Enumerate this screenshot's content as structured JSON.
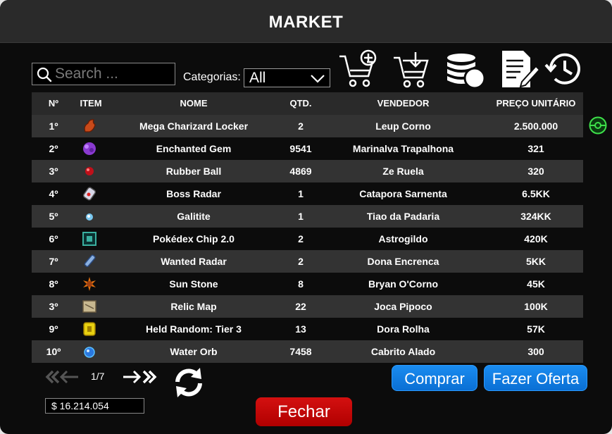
{
  "window": {
    "title": "MARKET"
  },
  "search": {
    "placeholder": "Search ..."
  },
  "category": {
    "label": "Categorias:",
    "selected": "All"
  },
  "toolbar": [
    {
      "name": "add-to-cart-icon"
    },
    {
      "name": "cart-download-icon"
    },
    {
      "name": "coins-icon"
    },
    {
      "name": "edit-document-icon"
    },
    {
      "name": "history-icon"
    }
  ],
  "table": {
    "headers": {
      "num": "Nº",
      "item": "ITEM",
      "name": "NOME",
      "qtd": "QTD.",
      "seller": "VENDEDOR",
      "price": "PREÇO UNITÁRIO"
    },
    "rows": [
      {
        "num": "1º",
        "icon": "charizard-locker-icon",
        "color": "#c84a1a",
        "name": "Mega Charizard Locker",
        "qtd": "2",
        "seller": "Leup Corno",
        "price": "2.500.000"
      },
      {
        "num": "2º",
        "icon": "gem-icon",
        "color": "#8a3ad0",
        "name": "Enchanted Gem",
        "qtd": "9541",
        "seller": "Marinalva Trapalhona",
        "price": "321"
      },
      {
        "num": "3º",
        "icon": "rubber-ball-icon",
        "color": "#c0101a",
        "name": "Rubber Ball",
        "qtd": "4869",
        "seller": "Ze Ruela",
        "price": "320"
      },
      {
        "num": "4º",
        "icon": "boss-radar-icon",
        "color": "#d8d8e8",
        "name": "Boss Radar",
        "qtd": "1",
        "seller": "Catapora Sarnenta",
        "price": "6.5KK"
      },
      {
        "num": "5º",
        "icon": "galitite-icon",
        "color": "#7ac8f0",
        "name": "Galitite",
        "qtd": "1",
        "seller": "Tiao da Padaria",
        "price": "324KK"
      },
      {
        "num": "6º",
        "icon": "pokedex-chip-icon",
        "color": "#3ab0a0",
        "name": "Pokédex Chip 2.0",
        "qtd": "2",
        "seller": "Astrogildo",
        "price": "420K"
      },
      {
        "num": "7º",
        "icon": "wanted-radar-icon",
        "color": "#8ab0e0",
        "name": "Wanted Radar",
        "qtd": "2",
        "seller": "Dona Encrenca",
        "price": "5KK"
      },
      {
        "num": "8º",
        "icon": "sun-stone-icon",
        "color": "#e07010",
        "name": "Sun Stone",
        "qtd": "8",
        "seller": "Bryan O'Corno",
        "price": "45K"
      },
      {
        "num": "3º",
        "icon": "relic-map-icon",
        "color": "#a09070",
        "name": "Relic Map",
        "qtd": "22",
        "seller": "Joca Pipoco",
        "price": "100K"
      },
      {
        "num": "9º",
        "icon": "held-random-icon",
        "color": "#e8d010",
        "name": "Held Random: Tier 3",
        "qtd": "13",
        "seller": "Dora Rolha",
        "price": "57K"
      },
      {
        "num": "10º",
        "icon": "water-orb-icon",
        "color": "#2a78e0",
        "name": "Water Orb",
        "qtd": "7458",
        "seller": "Cabrito Alado",
        "price": "300"
      }
    ]
  },
  "pager": {
    "current": "1/7"
  },
  "balance": "$ 16.214.054",
  "buttons": {
    "buy": "Comprar",
    "offer": "Fazer Oferta",
    "close": "Fechar"
  },
  "colors": {
    "accent_blue": "#0a6fd4",
    "close_red": "#c00000",
    "row_alt": "#333333",
    "header": "#2a2a2a"
  }
}
